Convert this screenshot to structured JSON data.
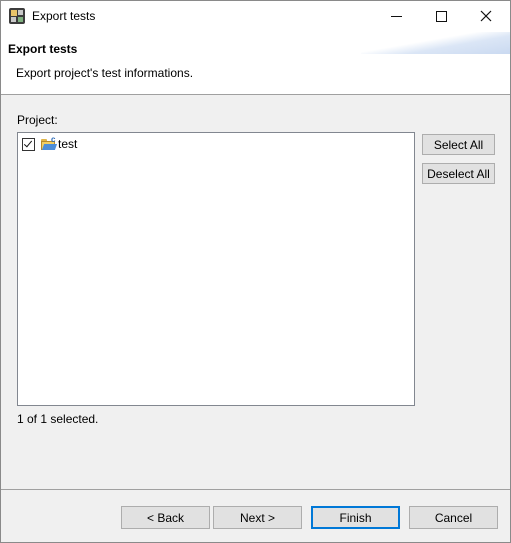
{
  "window": {
    "title": "Export tests"
  },
  "banner": {
    "title": "Export tests",
    "description": "Export project's test informations."
  },
  "project": {
    "label": "Project:",
    "items": [
      {
        "label": "test",
        "checked": true,
        "icon": "project-folder-icon"
      }
    ],
    "selection_status": "1 of 1 selected."
  },
  "side_buttons": {
    "select_all": "Select All",
    "deselect_all": "Deselect All"
  },
  "footer": {
    "back": "< Back",
    "next": "Next >",
    "finish": "Finish",
    "cancel": "Cancel"
  },
  "colors": {
    "default_button_border": "#0078d7",
    "button_face": "#e1e1e1",
    "dialog_background": "#f0f0f0"
  }
}
